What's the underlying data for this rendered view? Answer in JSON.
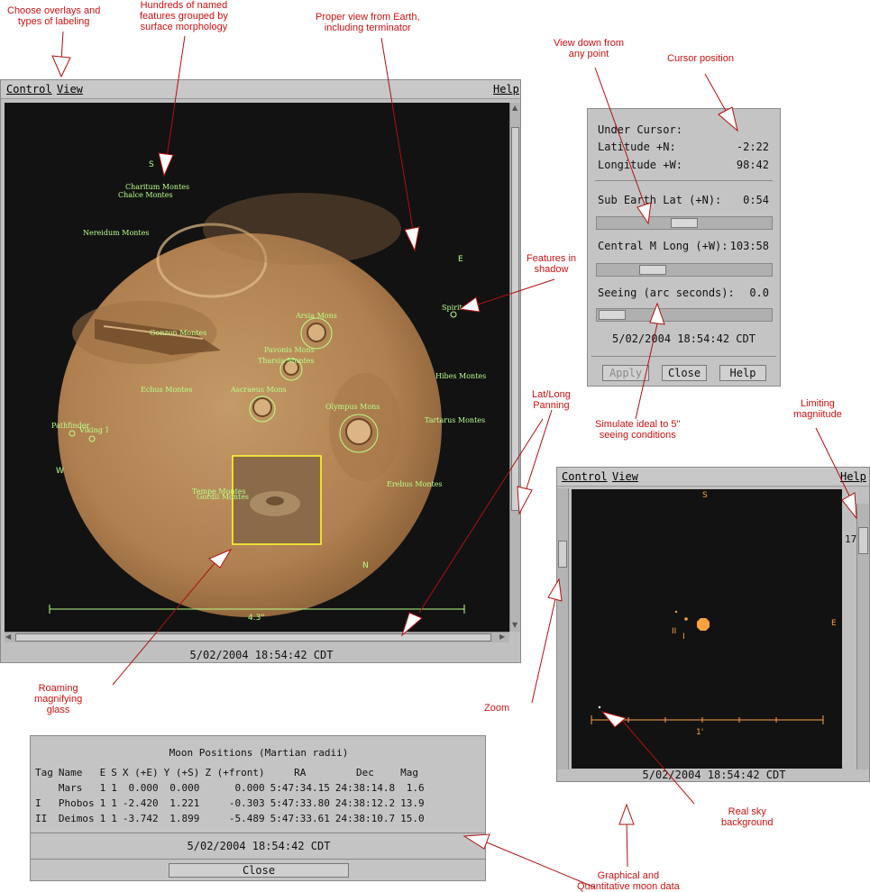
{
  "annotations": {
    "overlays": "Choose overlays and\ntypes of labeling",
    "features": "Hundreds of named\nfeatures grouped by\nsurface morphology",
    "proper_view": "Proper view from Earth,\nincluding terminator",
    "view_down": "View down from\nany point",
    "cursor_position": "Cursor position",
    "shadow": "Features in\nshadow",
    "latlong": "Lat/Long\nPanning",
    "limiting_mag": "Limiting\nmagniitude",
    "seeing": "Simulate ideal to 5\"\nseeing conditions",
    "magnifier": "Roaming\nmagnifying\nglass",
    "zoom": "Zoom",
    "real_sky": "Real sky\nbackground",
    "moon_data": "Graphical and\nQuantitative moon data"
  },
  "main_window": {
    "menu": {
      "control": "Control",
      "view": "View",
      "help": "Help"
    },
    "directions": {
      "s": "S",
      "e": "E",
      "w": "W",
      "n": "N"
    },
    "features": [
      "Charitum Montes",
      "Chalce Montes",
      "Nereidum Montes",
      "Arsia Mons",
      "Spirit",
      "Gonzon Montes",
      "Pavonis Mons",
      "Tharsis Montes",
      "Hibes Montes",
      "Echus Montes",
      "Ascraeus Mons",
      "Olympus Mons",
      "Tartarus Montes",
      "Pathfinder",
      "Viking 1",
      "Erebus Montes",
      "Tempe Montes",
      "Gordii Montes"
    ],
    "scale_label": "4.3\"",
    "status": "5/02/2004 18:54:42 CDT"
  },
  "cursor_panel": {
    "under_cursor": "Under Cursor:",
    "lat_label": "Latitude +N:",
    "lat_value": "-2:22",
    "long_label": "Longitude +W:",
    "long_value": "98:42",
    "sub_earth_label": "Sub Earth Lat (+N):",
    "sub_earth_value": "0:54",
    "sub_earth_level": 0.5,
    "central_label": "Central M Long (+W):",
    "central_value": "103:58",
    "central_level": 0.28,
    "seeing_label": "Seeing (arc seconds):",
    "seeing_value": "0.0",
    "seeing_level": 0.0,
    "datetime": "5/02/2004 18:54:42 CDT",
    "apply": "Apply",
    "close": "Close",
    "help": "Help"
  },
  "sky_window": {
    "menu": {
      "control": "Control",
      "view": "View",
      "help": "Help"
    },
    "directions": {
      "s": "S",
      "e": "E"
    },
    "moon_labels": {
      "ii": "II",
      "i": "I"
    },
    "limiting_mag": "17",
    "scale_label": "1'",
    "status": "5/02/2004 18:54:42 CDT"
  },
  "moon_table": {
    "title": "Moon Positions (Martian radii)",
    "headers": [
      "Tag",
      "Name",
      "E",
      "S",
      "X (+E)",
      "Y (+S)",
      "Z (+front)",
      "RA",
      "Dec",
      "Mag"
    ],
    "rows": [
      [
        "",
        "Mars",
        "1",
        "1",
        "0.000",
        "0.000",
        "0.000",
        "5:47:34.15",
        "24:38:14.8",
        "1.6"
      ],
      [
        "I",
        "Phobos",
        "1",
        "1",
        "-2.420",
        "1.221",
        "-0.303",
        "5:47:33.80",
        "24:38:12.2",
        "13.9"
      ],
      [
        "II",
        "Deimos",
        "1",
        "1",
        "-3.742",
        "1.899",
        "-5.489",
        "5:47:33.61",
        "24:38:10.7",
        "15.0"
      ]
    ],
    "datetime": "5/02/2004 18:54:42 CDT",
    "close": "Close"
  },
  "colors": {
    "mars": "#b88a55",
    "feature_label": "#b8ff8a",
    "annotation": "#cc1010",
    "sky_object": "#ffa040"
  }
}
